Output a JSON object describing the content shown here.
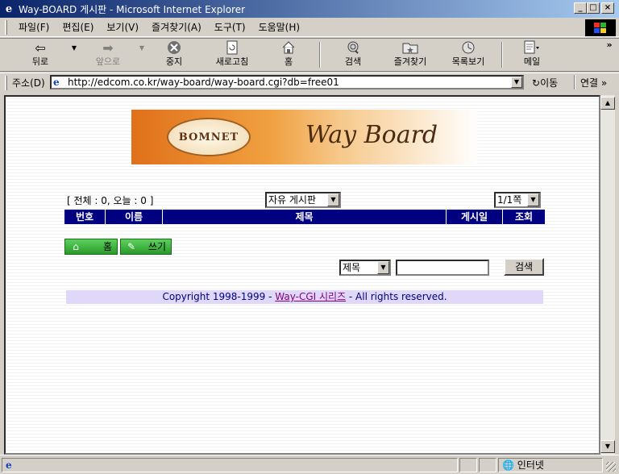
{
  "window": {
    "title": "Way-BOARD 게시판 - Microsoft Internet Explorer",
    "minimize": "_",
    "maximize": "□",
    "close": "×"
  },
  "menu": [
    "파일(F)",
    "편집(E)",
    "보기(V)",
    "즐겨찾기(A)",
    "도구(T)",
    "도움말(H)"
  ],
  "toolbar": {
    "back": "뒤로",
    "forward": "앞으로",
    "stop": "중지",
    "refresh": "새로고침",
    "home": "홈",
    "search": "검색",
    "favorites": "즐겨찾기",
    "history": "목록보기",
    "mail": "메일",
    "more": "»"
  },
  "address": {
    "label": "주소(D)",
    "url": "http://edcom.co.kr/way-board/way-board.cgi?db=free01",
    "go": "이동",
    "links": "연결 »"
  },
  "banner": {
    "logo": "BOMNET",
    "title": "Way Board"
  },
  "board": {
    "stats": "[ 전체 : 0, 오늘 : 0 ]",
    "board_select": "자유 게시판",
    "page_select": "1/1쪽",
    "columns": [
      "번호",
      "이름",
      "제목",
      "게시일",
      "조회"
    ],
    "home_button": "홈",
    "write_button": "쓰기",
    "search_field_select": "제목",
    "search_value": "",
    "search_button": "검색"
  },
  "footer": {
    "prefix": "Copyright 1998-1999 - ",
    "link": "Way-CGI 시리즈",
    "suffix": " - All rights reserved."
  },
  "status": {
    "text": "",
    "zone": "인터넷"
  }
}
